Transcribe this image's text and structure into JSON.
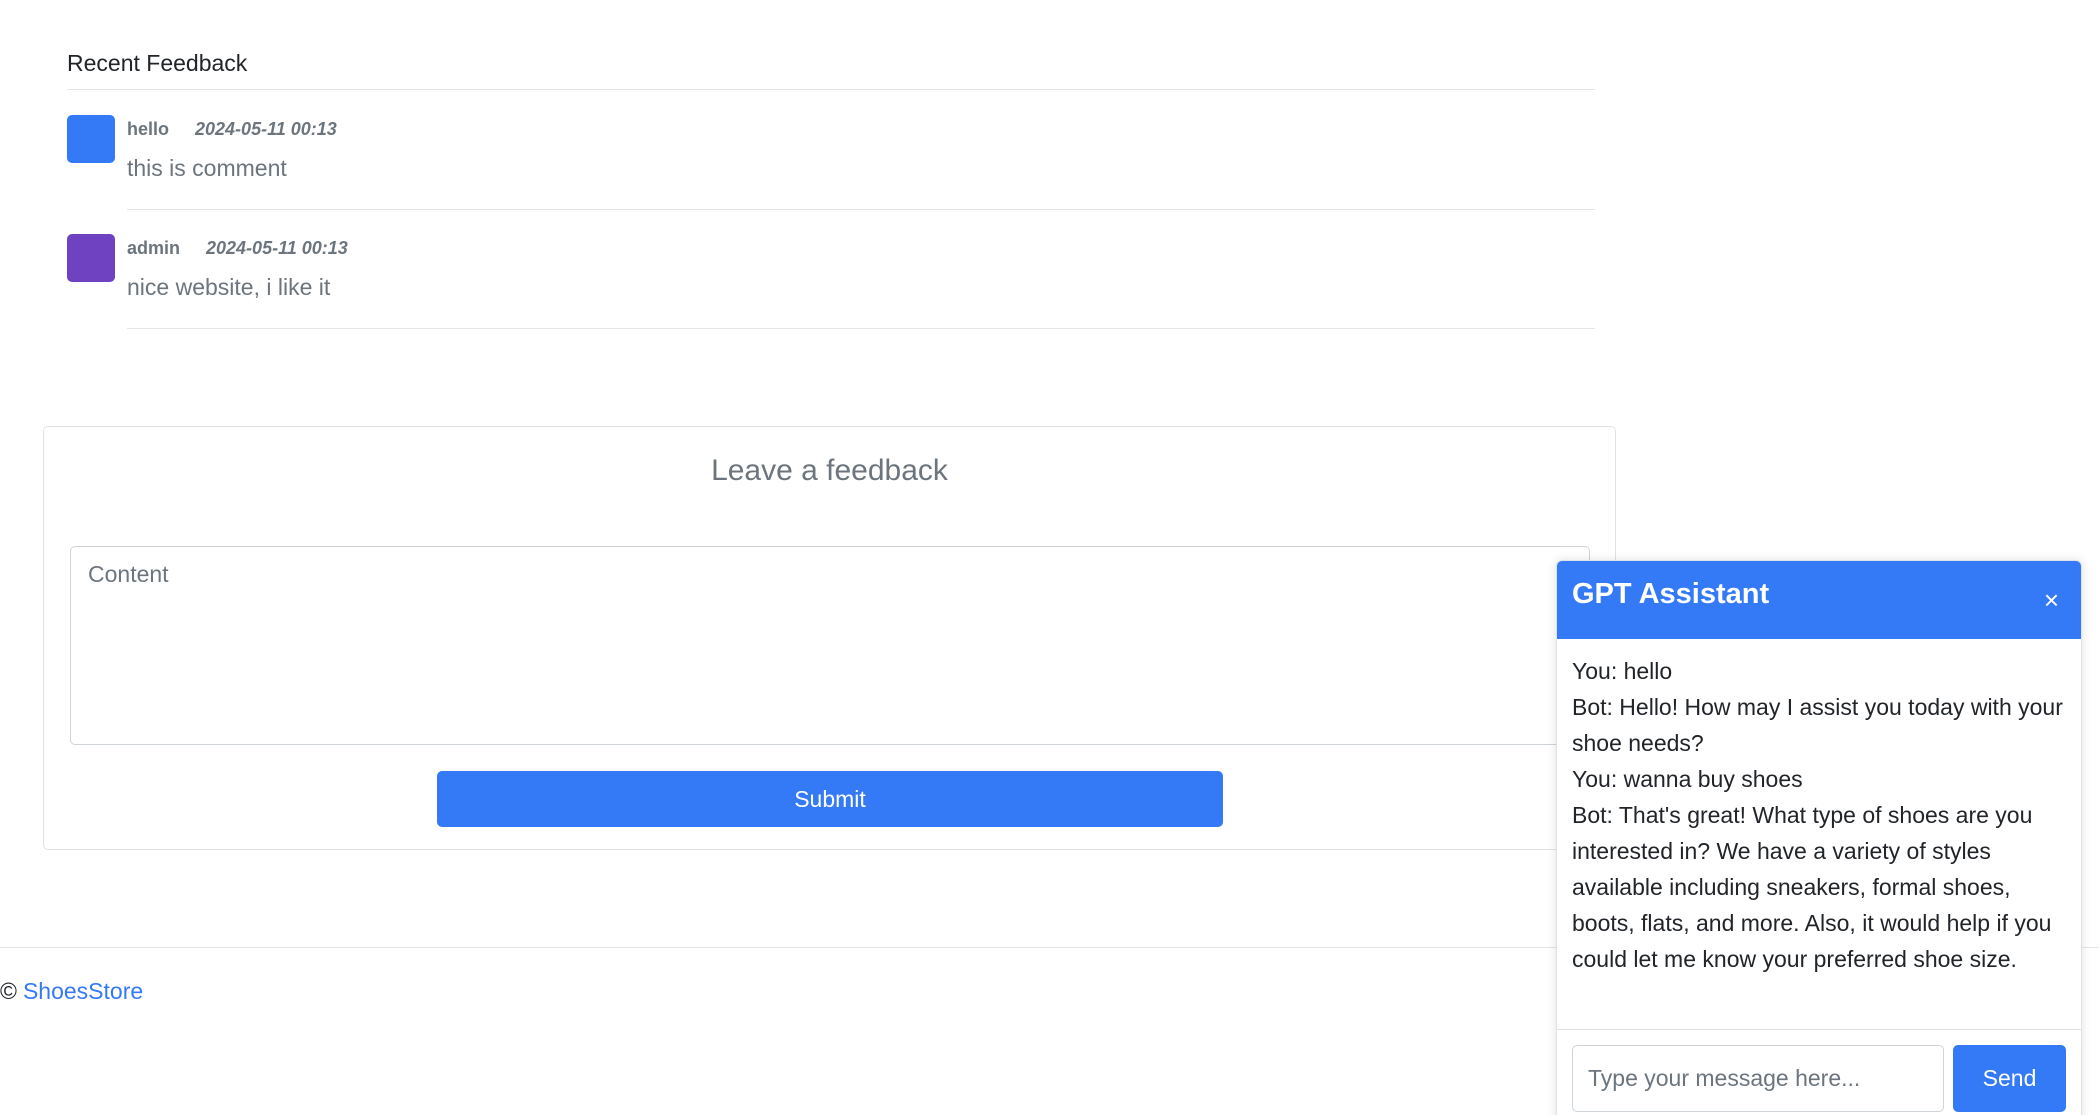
{
  "recent_feedback": {
    "title": "Recent Feedback",
    "comments": [
      {
        "author": "hello",
        "date": "2024-05-11 00:13",
        "text": "this is comment",
        "avatar_color": "#3479f6"
      },
      {
        "author": "admin",
        "date": "2024-05-11 00:13",
        "text": "nice website, i like it",
        "avatar_color": "#6f42c1"
      }
    ]
  },
  "feedback_form": {
    "title": "Leave a feedback",
    "content_placeholder": "Content",
    "content_value": "",
    "submit_label": "Submit"
  },
  "footer": {
    "copyright_symbol": "©",
    "brand_link": "ShoesStore"
  },
  "chat": {
    "title": "GPT Assistant",
    "close_icon": "×",
    "messages": [
      "You: hello",
      "Bot: Hello! How may I assist you today with your shoe needs?",
      "You: wanna buy shoes",
      "Bot: That's great! What type of shoes are you interested in? We have a variety of styles available including sneakers, formal shoes, boots, flats, and more. Also, it would help if you could let me know your preferred shoe size."
    ],
    "input_placeholder": "Type your message here...",
    "input_value": "",
    "send_label": "Send"
  },
  "colors": {
    "primary": "#3479f6",
    "muted_text": "#6c757d",
    "border": "#dfe2e6"
  }
}
